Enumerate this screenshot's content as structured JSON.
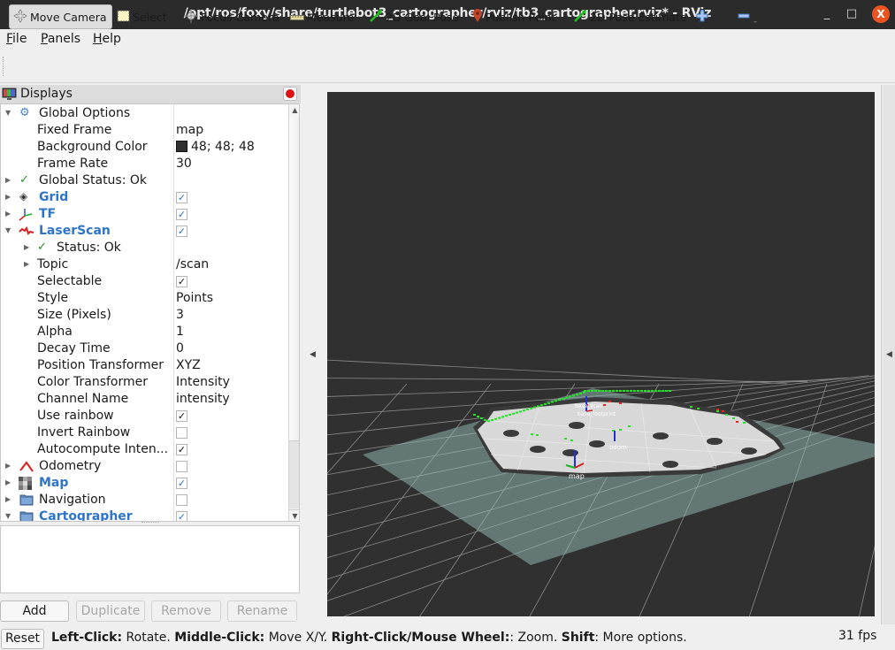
{
  "window": {
    "title": "/opt/ros/foxy/share/turtlebot3_cartographer/rviz/tb3_cartographer.rviz* - RViz",
    "controls": {
      "minimize": "_",
      "maximize": "□",
      "close": "X"
    }
  },
  "menu": [
    {
      "label": "File",
      "mnemonic": "F",
      "rest": "ile"
    },
    {
      "label": "Panels",
      "mnemonic": "P",
      "rest": "anels"
    },
    {
      "label": "Help",
      "mnemonic": "H",
      "rest": "elp"
    }
  ],
  "toolbar": {
    "tools": [
      {
        "label": "Move Camera",
        "icon": "move-camera-icon",
        "active": true
      },
      {
        "label": "Select",
        "icon": "select-icon",
        "active": false
      },
      {
        "label": "Focus Camera",
        "icon": "focus-camera-icon",
        "active": false
      },
      {
        "label": "Measure",
        "icon": "ruler-icon",
        "active": false
      },
      {
        "label": "2D Goal Pose",
        "icon": "green-arrow-icon",
        "active": false
      },
      {
        "label": "Publish Point",
        "icon": "map-pin-icon",
        "active": false
      },
      {
        "label": "2D Pose Estimate",
        "icon": "green-arrow-icon",
        "active": false
      }
    ],
    "add_tool_icon": "plus-icon",
    "remove_tool_icon": "minus-icon"
  },
  "displays": {
    "title": "Displays",
    "rows": [
      {
        "name": "Global Options",
        "value": "",
        "kind": "group",
        "expanded": true
      },
      {
        "name": "Fixed Frame",
        "value": "map",
        "kind": "prop"
      },
      {
        "name": "Background Color",
        "value": "48; 48; 48",
        "kind": "color",
        "color": "#303030"
      },
      {
        "name": "Frame Rate",
        "value": "30",
        "kind": "prop"
      },
      {
        "name": "Global Status: Ok",
        "value": "",
        "kind": "status"
      },
      {
        "name": "Grid",
        "checked": true,
        "kind": "display"
      },
      {
        "name": "TF",
        "checked": true,
        "kind": "display"
      },
      {
        "name": "LaserScan",
        "checked": true,
        "kind": "display",
        "expanded": true
      },
      {
        "name": "Status: Ok",
        "value": "",
        "kind": "status"
      },
      {
        "name": "Topic",
        "value": "/scan",
        "kind": "prop"
      },
      {
        "name": "Selectable",
        "checked": true,
        "kind": "bool"
      },
      {
        "name": "Style",
        "value": "Points",
        "kind": "prop"
      },
      {
        "name": "Size (Pixels)",
        "value": "3",
        "kind": "prop"
      },
      {
        "name": "Alpha",
        "value": "1",
        "kind": "prop"
      },
      {
        "name": "Decay Time",
        "value": "0",
        "kind": "prop"
      },
      {
        "name": "Position Transformer",
        "value": "XYZ",
        "kind": "prop"
      },
      {
        "name": "Color Transformer",
        "value": "Intensity",
        "kind": "prop"
      },
      {
        "name": "Channel Name",
        "value": "intensity",
        "kind": "prop"
      },
      {
        "name": "Use rainbow",
        "checked": true,
        "kind": "bool"
      },
      {
        "name": "Invert Rainbow",
        "checked": false,
        "kind": "bool"
      },
      {
        "name": "Autocompute Inten...",
        "checked": true,
        "kind": "bool"
      },
      {
        "name": "Odometry",
        "checked": false,
        "kind": "display"
      },
      {
        "name": "Map",
        "checked": true,
        "kind": "display"
      },
      {
        "name": "Navigation",
        "checked": false,
        "kind": "display"
      },
      {
        "name": "Cartographer",
        "checked": true,
        "kind": "display",
        "expanded": true
      }
    ],
    "buttons": {
      "add": "Add",
      "duplicate": "Duplicate",
      "remove": "Remove",
      "rename": "Rename"
    }
  },
  "viewport": {
    "background": "#303030",
    "frame_labels": [
      "map",
      "odom",
      "base_footprint",
      "base_scan"
    ]
  },
  "statusbar": {
    "reset": "Reset",
    "hint": [
      {
        "b": "Left-Click:",
        "t": " Rotate. "
      },
      {
        "b": "Middle-Click:",
        "t": " Move X/Y. "
      },
      {
        "b": "Right-Click/Mouse Wheel:",
        "t": ": Zoom. "
      },
      {
        "b": "Shift",
        "t": ": More options."
      }
    ],
    "fps": "31 fps"
  }
}
